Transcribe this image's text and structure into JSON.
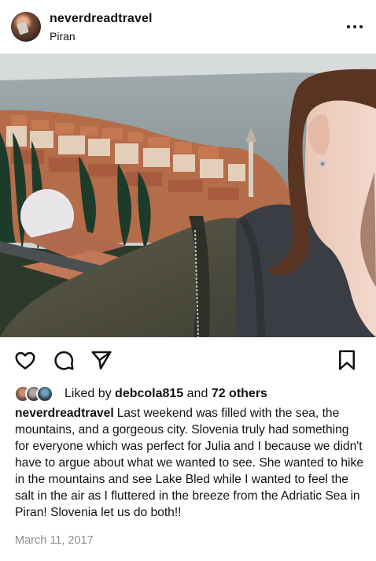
{
  "post": {
    "username": "neverdreadtravel",
    "location": "Piran",
    "likes": {
      "prefix": "Liked by",
      "user": "debcola815",
      "middle": "and",
      "others": "72 others"
    },
    "caption_user": "neverdreadtravel",
    "caption_text": "Last weekend was filled with the sea, the mountains, and a gorgeous city. Slovenia truly had something for everyone which was perfect for Julia and I because we didn't have to argue about what we wanted to see. She wanted to hike in the mountains and see Lake Bled while I wanted to feel the salt in the air as I fluttered in the breeze from the Adriatic Sea in Piran! Slovenia let us do both!!",
    "date": "March 11, 2017"
  },
  "icons": {
    "more": "more-options-icon",
    "like": "heart-icon",
    "comment": "comment-icon",
    "share": "send-icon",
    "save": "bookmark-icon"
  },
  "colors": {
    "text": "#111111",
    "muted": "#8e8e8e",
    "background": "#ffffff"
  }
}
